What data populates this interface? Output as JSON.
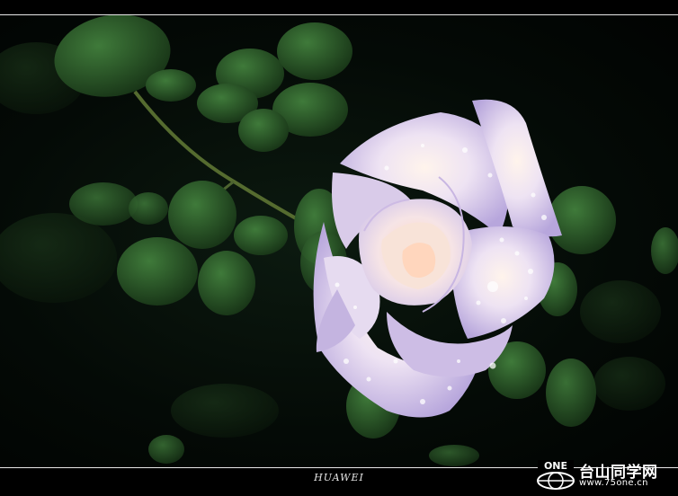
{
  "photo": {
    "subject": "pale pink rose with water droplets on dark foliage",
    "caption": "HUAWEI"
  },
  "watermark": {
    "mark_text": "ONE",
    "site_name": "台山同学网",
    "url": "www.75one.cn"
  },
  "colors": {
    "background": "#000000",
    "petal_light": "#f3eaf5",
    "petal_shadow": "#b9a9dc",
    "leaf": "#2d5a2a",
    "rule": "#e8e8e8"
  }
}
